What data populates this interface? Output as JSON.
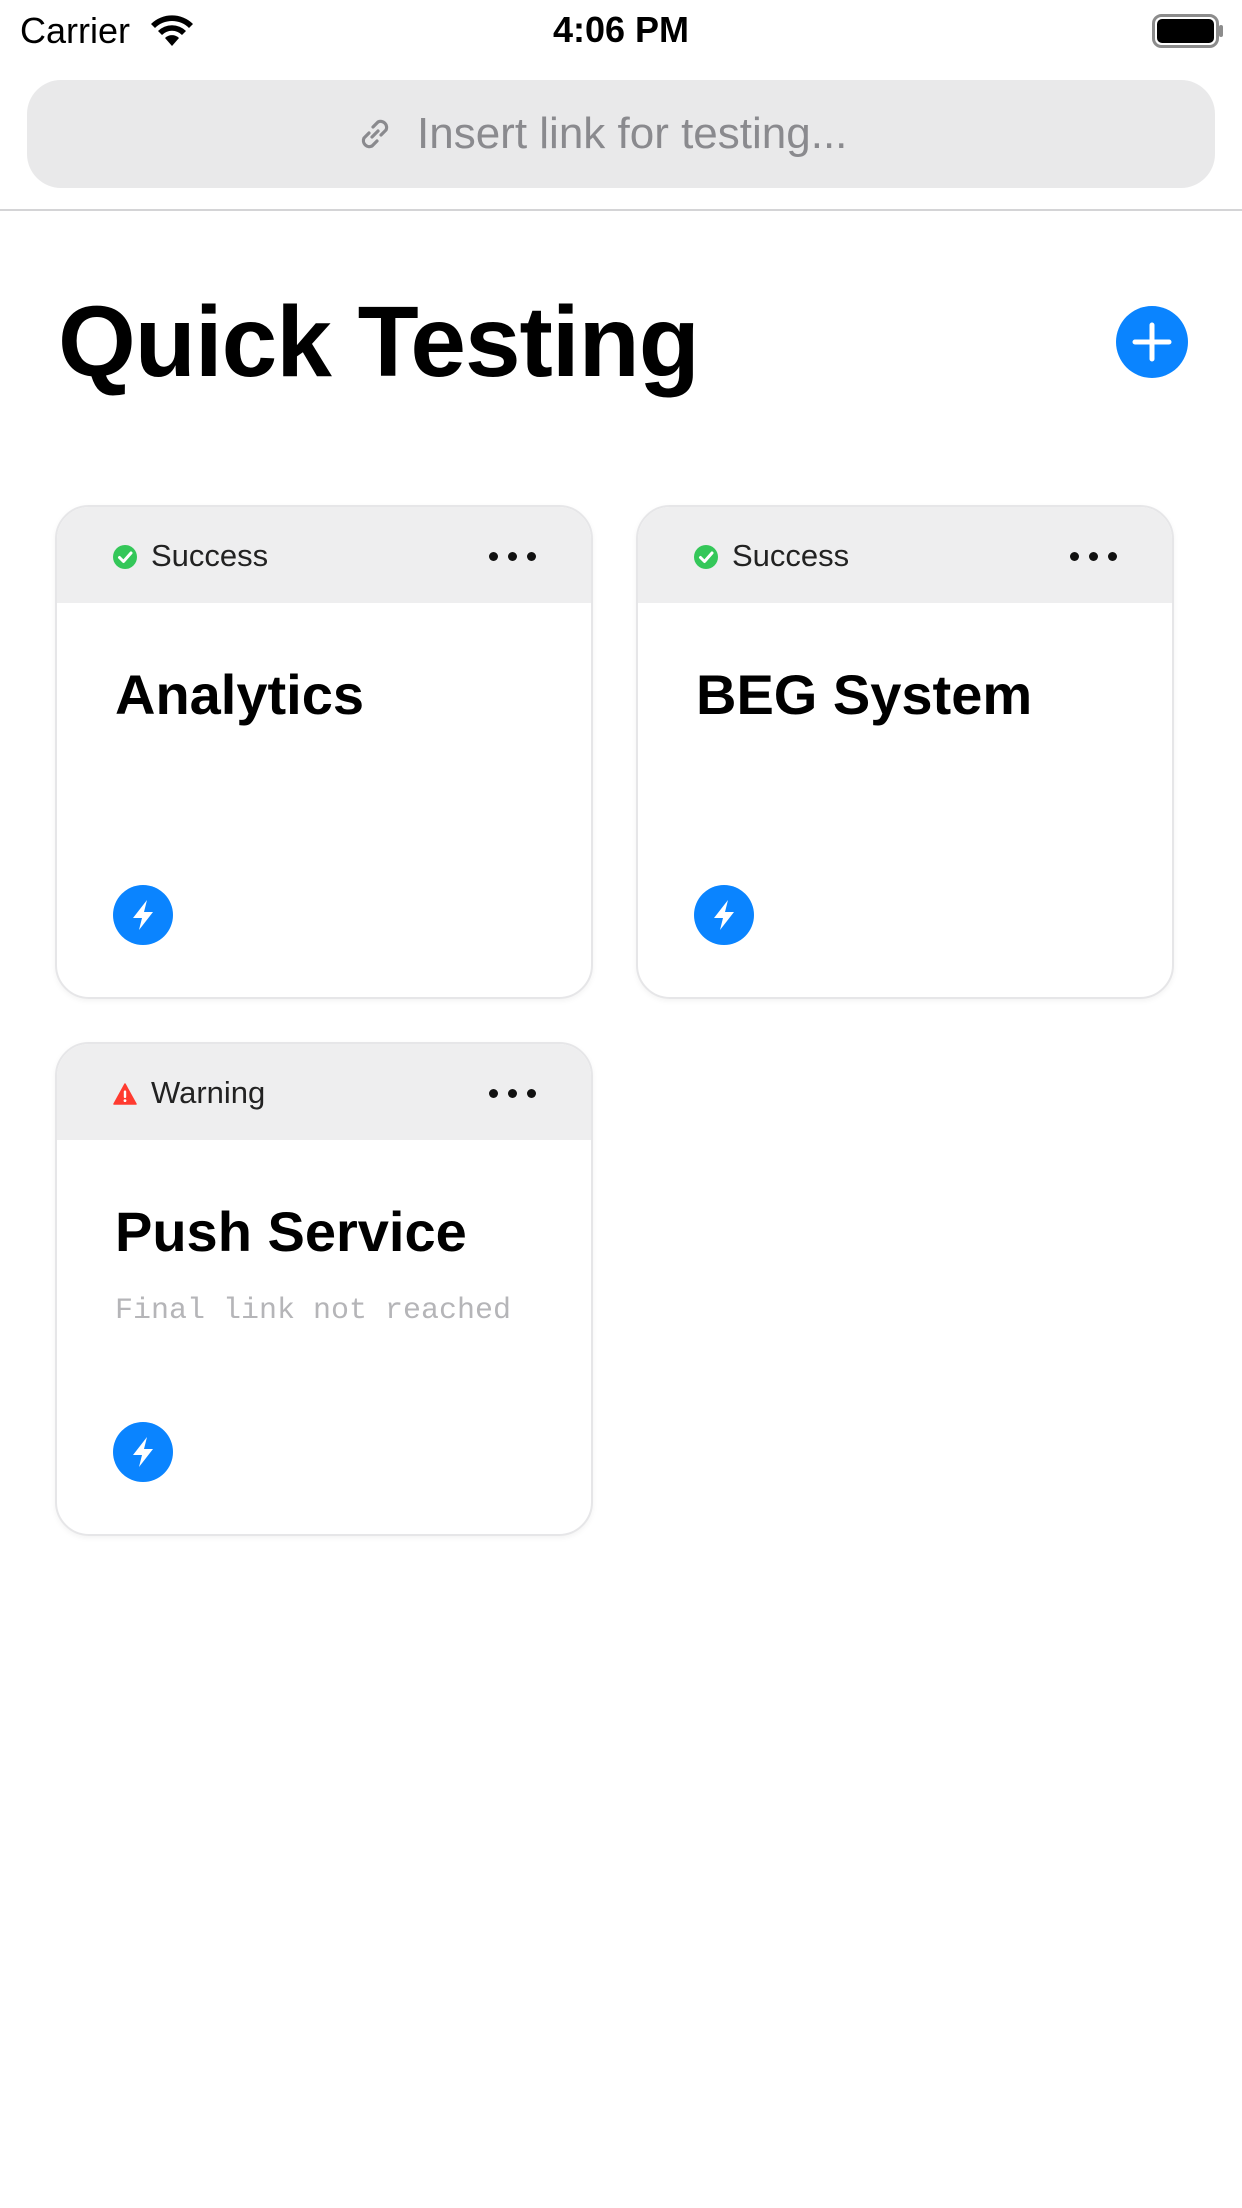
{
  "status_bar": {
    "carrier": "Carrier",
    "time": "4:06 PM"
  },
  "search": {
    "placeholder": "Insert link for testing..."
  },
  "header": {
    "title": "Quick Testing"
  },
  "colors": {
    "accent": "#0a84ff",
    "success": "#34c759",
    "warning": "#ff3b30"
  },
  "icons": {
    "search": "link-icon",
    "add": "plus-circle-icon",
    "run": "bolt-icon",
    "more": "ellipsis-icon"
  },
  "cards": [
    {
      "status": "Success",
      "status_icon": "check-circle-icon",
      "title": "Analytics",
      "subtitle": ""
    },
    {
      "status": "Success",
      "status_icon": "check-circle-icon",
      "title": "BEG System",
      "subtitle": ""
    },
    {
      "status": "Warning",
      "status_icon": "warning-triangle-icon",
      "title": "Push Service",
      "subtitle": "Final link not reached"
    }
  ]
}
